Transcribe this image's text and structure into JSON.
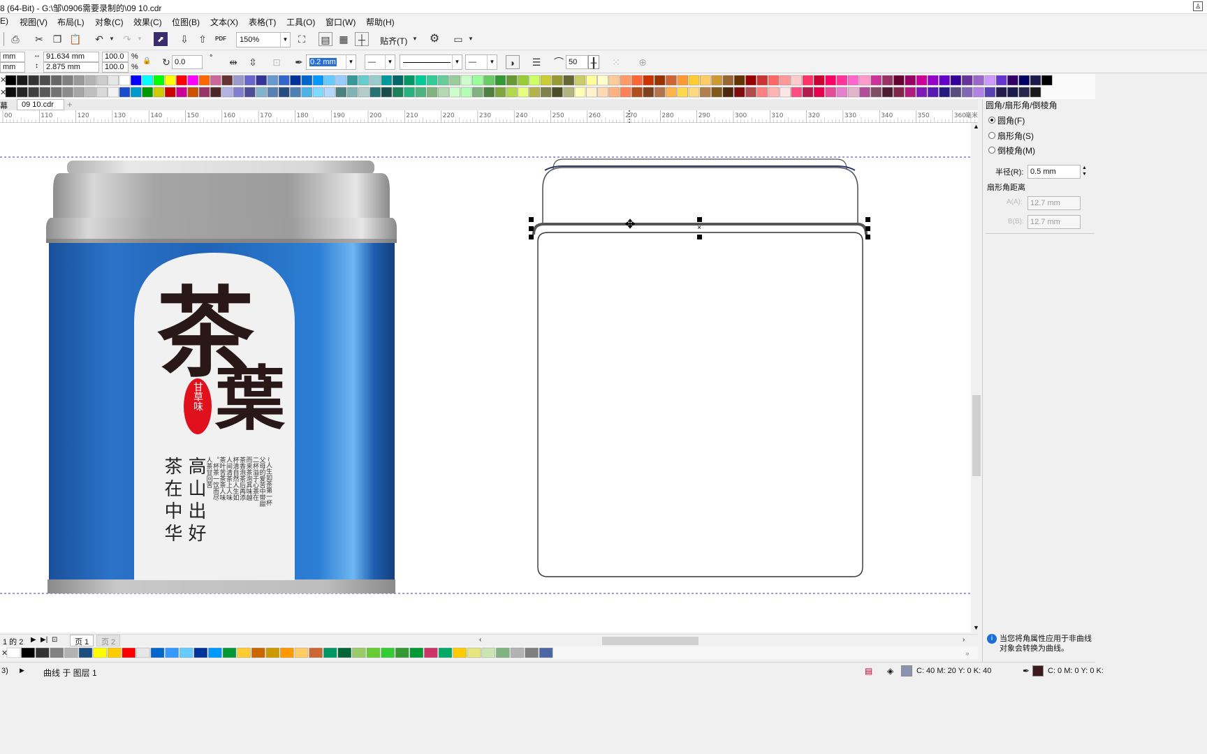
{
  "window": {
    "title": "8 (64-Bit) - G:\\邹\\0906需要录制的\\09 10.cdr"
  },
  "menu": [
    {
      "label": "E)"
    },
    {
      "label": "视图(V)"
    },
    {
      "label": "布局(L)"
    },
    {
      "label": "对象(C)"
    },
    {
      "label": "效果(C)"
    },
    {
      "label": "位图(B)"
    },
    {
      "label": "文本(X)"
    },
    {
      "label": "表格(T)"
    },
    {
      "label": "工具(O)"
    },
    {
      "label": "窗口(W)"
    },
    {
      "label": "帮助(H)"
    }
  ],
  "toolbar1": {
    "zoom": "150%",
    "snap_label": "贴齐(T)",
    "pdf_label": "PDF"
  },
  "toolbar2": {
    "pos_x": "mm",
    "pos_y": "mm",
    "width": "91.634 mm",
    "height": "2.875 mm",
    "scale_x": "100.0",
    "scale_y": "100.0",
    "pct1": "%",
    "pct2": "%",
    "rotation": "0.0",
    "degree": "°",
    "outline_width": "0.2 mm",
    "smooth": "50"
  },
  "colors": {
    "palette_row1": [
      "#000000",
      "#1a1a1a",
      "#333333",
      "#4d4d4d",
      "#666666",
      "#808080",
      "#999999",
      "#b3b3b3",
      "#cccccc",
      "#e6e6e6",
      "#ffffff",
      "#0000ff",
      "#00ffff",
      "#00ff00",
      "#ffff00",
      "#ff0000",
      "#ff00ff",
      "#ff6600",
      "#cc6699",
      "#663333",
      "#9999cc",
      "#6666cc",
      "#333399",
      "#6699cc",
      "#3366cc",
      "#003399",
      "#0066cc",
      "#0099ff",
      "#66ccff",
      "#99ccff",
      "#339999",
      "#66cccc",
      "#99cccc",
      "#009999",
      "#006666",
      "#009966",
      "#00cc99",
      "#33cc99",
      "#66cc99",
      "#99cc99",
      "#ccffcc",
      "#99ff99",
      "#66cc66",
      "#339933",
      "#669933",
      "#99cc33",
      "#ccff66",
      "#cccc33",
      "#999933",
      "#666633",
      "#cccc66",
      "#ffff99",
      "#ffffcc",
      "#ffcc99",
      "#ff9966",
      "#ff6633",
      "#cc3300",
      "#993300",
      "#cc6633",
      "#ff9933",
      "#ffcc33",
      "#ffcc66",
      "#cc9933",
      "#996633",
      "#663300",
      "#990000",
      "#cc3333",
      "#ff6666",
      "#ff9999",
      "#ffcccc",
      "#ff3366",
      "#cc0033",
      "#ff0066",
      "#ff3399",
      "#ff66cc",
      "#ff99cc",
      "#cc3399",
      "#993366",
      "#660033",
      "#990066",
      "#cc0099",
      "#9900cc",
      "#6600cc",
      "#330099",
      "#663399",
      "#9966cc",
      "#cc99ff",
      "#6633cc",
      "#330066",
      "#000066",
      "#1a1a4d",
      "#000000"
    ],
    "palette_row2": [
      "#0d0d0d",
      "#262626",
      "#404040",
      "#595959",
      "#737373",
      "#8c8c8c",
      "#a6a6a6",
      "#bfbfbf",
      "#d9d9d9",
      "#f2f2f2",
      "#1a4dcc",
      "#0099cc",
      "#009900",
      "#cccc00",
      "#cc0000",
      "#cc0099",
      "#cc5200",
      "#993366",
      "#4d2626",
      "#b3b3e6",
      "#8080cc",
      "#4d4d99",
      "#80b3cc",
      "#5980b3",
      "#264d80",
      "#4d80b3",
      "#4db3e6",
      "#80d9ff",
      "#b3d9ff",
      "#4d8080",
      "#80b3b3",
      "#b3cccc",
      "#267373",
      "#1a4d4d",
      "#1a8059",
      "#26b380",
      "#4db380",
      "#80b380",
      "#b3d9b3",
      "#ccffcc",
      "#b3ffb3",
      "#80b380",
      "#4d8040",
      "#80a640",
      "#b3d94d",
      "#e6ff80",
      "#b3b34d",
      "#80804d",
      "#4d4d26",
      "#b3b380",
      "#ffffb3",
      "#fff2cc",
      "#ffd9b3",
      "#ffb380",
      "#ff8059",
      "#b34d1a",
      "#80401a",
      "#b3734d",
      "#ffb34d",
      "#ffd94d",
      "#ffd980",
      "#b3804d",
      "#80591a",
      "#4d260d",
      "#800d0d",
      "#b34d4d",
      "#ff8080",
      "#ffb3b3",
      "#ffe6e6",
      "#ff4d80",
      "#b31a4d",
      "#e6004d",
      "#e64d99",
      "#e680cc",
      "#e6b3cc",
      "#b34d99",
      "#804d66",
      "#4d1a33",
      "#80264d",
      "#b31a80",
      "#8019b3",
      "#5919b3",
      "#261a80",
      "#594d80",
      "#8066b3",
      "#b380e6",
      "#5940b3",
      "#261a4d",
      "#1a1a4d",
      "#26264d",
      "#1a1a1a"
    ],
    "bottom_palette": [
      "#ffffff",
      "#000000",
      "#333333",
      "#808080",
      "#b3b3b3",
      "#1a4d80",
      "#ffff00",
      "#ffcc00",
      "#ff0000",
      "#e6e6e6",
      "#0066cc",
      "#3399ff",
      "#66ccff",
      "#003399",
      "#0099ff",
      "#009933",
      "#ffcc33",
      "#cc6600",
      "#cc9900",
      "#ff9900",
      "#ffcc66",
      "#cc6633",
      "#009966",
      "#006633",
      "#99cc66",
      "#66cc33",
      "#33cc33",
      "#339933",
      "#009933",
      "#cc3366",
      "#00aa66",
      "#ffcc00",
      "#e6e680",
      "#cce6b3",
      "#80b380",
      "#b3b3b3",
      "#7f7f7f",
      "#4d66a6"
    ]
  },
  "tabs": {
    "panel_tab": "幕",
    "document_tab": "09 10.cdr",
    "add_tab": "+"
  },
  "ruler": {
    "labels": [
      "00",
      "110",
      "120",
      "130",
      "140",
      "150",
      "160",
      "170",
      "180",
      "190",
      "200",
      "210",
      "220",
      "230",
      "240",
      "250",
      "260",
      "270",
      "280",
      "290",
      "300",
      "310",
      "320",
      "330",
      "340",
      "350",
      "360"
    ],
    "unit": "毫米"
  },
  "artwork": {
    "title_char1": "茶",
    "title_char2": "葉",
    "seal_text": "甘草味",
    "col1": "茶在中华",
    "col2": "高山出好",
    "poem_cols": [
      "~人生如茶第一杯",
      "父母的爱苦中带甜",
      "二杯溢于心茶在",
      "而来茶泡其味越",
      "茶香泡茶后再添",
      "杯清自然人生如",
      "人间清茶上人味",
      "茶叶苦茶茶人味",
      "。杯茶一饮而尽",
      "人茶甘回苦"
    ]
  },
  "docker": {
    "title": "圆角/扇形角/倒棱角",
    "option_round": "圆角(F)",
    "option_scallop": "扇形角(S)",
    "option_chamfer": "倒棱角(M)",
    "radius_label": "半径(R):",
    "radius_value": "0.5 mm",
    "scallop_distance_label": "扇形角距离",
    "a_label": "A(A):",
    "a_value": "12.7 mm",
    "b_label": "B(B):",
    "b_value": "12.7 mm",
    "note": "当您将角属性应用于非曲线对象会转换为曲线。"
  },
  "pagebar": {
    "page_of": "1 的 2",
    "page1": "页 1",
    "page2": "页 2"
  },
  "status": {
    "left": "3)",
    "object_info": "曲线 于 图层 1",
    "fill_cmyk": "C: 40 M: 20 Y: 0 K: 40",
    "outline_cmyk": "C: 0 M: 0 Y: 0 K:",
    "fill_color": "#8a94b0",
    "outline_color": "#3a1a1a"
  }
}
